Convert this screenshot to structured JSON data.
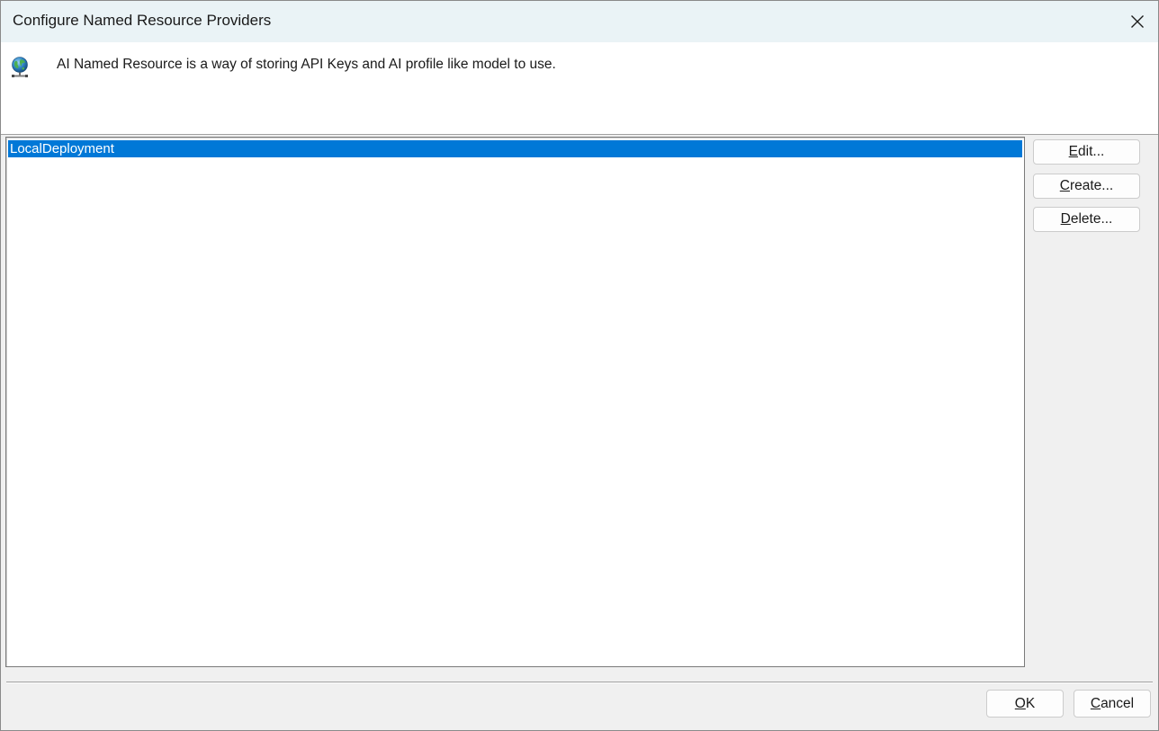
{
  "window": {
    "title": "Configure Named Resource Providers"
  },
  "header": {
    "description": "AI Named Resource is a way of storing API Keys and AI profile like model to use.",
    "icon": "globe-network-icon"
  },
  "list": {
    "items": [
      {
        "label": "LocalDeployment",
        "selected": true
      }
    ]
  },
  "side_buttons": {
    "edit": {
      "label": "Edit...",
      "mnemonic": "E"
    },
    "create": {
      "label": "Create...",
      "mnemonic": "C"
    },
    "delete": {
      "label": "Delete...",
      "mnemonic": "D"
    }
  },
  "footer_buttons": {
    "ok": {
      "label": "OK",
      "mnemonic": "O"
    },
    "cancel": {
      "label": "Cancel",
      "mnemonic": "C"
    }
  },
  "colors": {
    "selection": "#0078d7",
    "titlebar": "#eaf3f6"
  }
}
